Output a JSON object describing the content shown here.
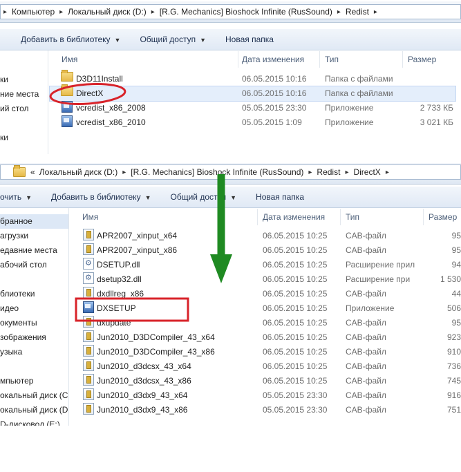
{
  "window1": {
    "breadcrumb": [
      "Компьютер",
      "Локальный диск (D:)",
      "[R.G. Mechanics] Bioshock Infinite (RusSound)",
      "Redist"
    ],
    "toolbar": {
      "add_library": "Добавить в библиотеку",
      "share": "Общий доступ",
      "new_folder": "Новая папка"
    },
    "nav": [
      "ки",
      "ние места",
      "ий стол",
      "",
      "ки"
    ],
    "columns": {
      "name": "Имя",
      "date": "Дата изменения",
      "type": "Тип",
      "size": "Размер"
    },
    "rows": [
      {
        "name": "D3D11Install",
        "date": "06.05.2015 10:16",
        "type": "Папка с файлами",
        "size": "",
        "icon": "folder-icon"
      },
      {
        "name": "DirectX",
        "date": "06.05.2015 10:16",
        "type": "Папка с файлами",
        "size": "",
        "icon": "folder-icon"
      },
      {
        "name": "vcredist_x86_2008",
        "date": "05.05.2015 23:30",
        "type": "Приложение",
        "size": "2 733 КБ",
        "icon": "exe-icon"
      },
      {
        "name": "vcredist_x86_2010",
        "date": "05.05.2015 1:09",
        "type": "Приложение",
        "size": "3 021 КБ",
        "icon": "exe-icon"
      }
    ]
  },
  "window2": {
    "back_glyph": "«",
    "breadcrumb": [
      "Локальный диск (D:)",
      "[R.G. Mechanics] Bioshock Infinite (RusSound)",
      "Redist",
      "DirectX"
    ],
    "toolbar": {
      "organize": "очить",
      "add_library": "Добавить в библиотеку",
      "share": "Общий доступ",
      "new_folder": "Новая папка"
    },
    "nav": [
      "бранное",
      "агрузки",
      "едавние места",
      "абочий стол",
      "",
      "блиотеки",
      "идео",
      "окументы",
      "зображения",
      "узыка",
      "",
      "мпьютер",
      "окальный диск (C",
      "окальный диск (D",
      "D-дисковод (E:)"
    ],
    "columns": {
      "name": "Имя",
      "date": "Дата изменения",
      "type": "Тип",
      "size": "Размер"
    },
    "rows": [
      {
        "name": "APR2007_xinput_x64",
        "date": "06.05.2015 10:25",
        "type": "CAB-файл",
        "size": "95",
        "icon": "cab-icon"
      },
      {
        "name": "APR2007_xinput_x86",
        "date": "06.05.2015 10:25",
        "type": "CAB-файл",
        "size": "95",
        "icon": "cab-icon"
      },
      {
        "name": "DSETUP.dll",
        "date": "06.05.2015 10:25",
        "type": "Расширение прил",
        "size": "94",
        "icon": "dll-icon"
      },
      {
        "name": "dsetup32.dll",
        "date": "06.05.2015 10:25",
        "type": "Расширение при",
        "size": "1 530",
        "icon": "dll-icon"
      },
      {
        "name": "dxdllreg_x86",
        "date": "06.05.2015 10:25",
        "type": "CAB-файл",
        "size": "44",
        "icon": "cab-icon"
      },
      {
        "name": "DXSETUP",
        "date": "06.05.2015 10:25",
        "type": "Приложение",
        "size": "506",
        "icon": "exe-icon"
      },
      {
        "name": "dxupdate",
        "date": "06.05.2015 10:25",
        "type": "CAB-файл",
        "size": "95",
        "icon": "cab-icon"
      },
      {
        "name": "Jun2010_D3DCompiler_43_x64",
        "date": "06.05.2015 10:25",
        "type": "CAB-файл",
        "size": "923",
        "icon": "cab-icon"
      },
      {
        "name": "Jun2010_D3DCompiler_43_x86",
        "date": "06.05.2015 10:25",
        "type": "CAB-файл",
        "size": "910",
        "icon": "cab-icon"
      },
      {
        "name": "Jun2010_d3dcsx_43_x64",
        "date": "06.05.2015 10:25",
        "type": "CAB-файл",
        "size": "736",
        "icon": "cab-icon"
      },
      {
        "name": "Jun2010_d3dcsx_43_x86",
        "date": "06.05.2015 10:25",
        "type": "CAB-файл",
        "size": "745",
        "icon": "cab-icon"
      },
      {
        "name": "Jun2010_d3dx9_43_x64",
        "date": "05.05.2015 23:30",
        "type": "CAB-файл",
        "size": "916",
        "icon": "cab-icon"
      },
      {
        "name": "Jun2010_d3dx9_43_x86",
        "date": "05.05.2015 23:30",
        "type": "CAB-файл",
        "size": "751",
        "icon": "cab-icon"
      }
    ]
  },
  "colors": {
    "annotation_red": "#d8232a",
    "annotation_green": "#1f8a22"
  }
}
